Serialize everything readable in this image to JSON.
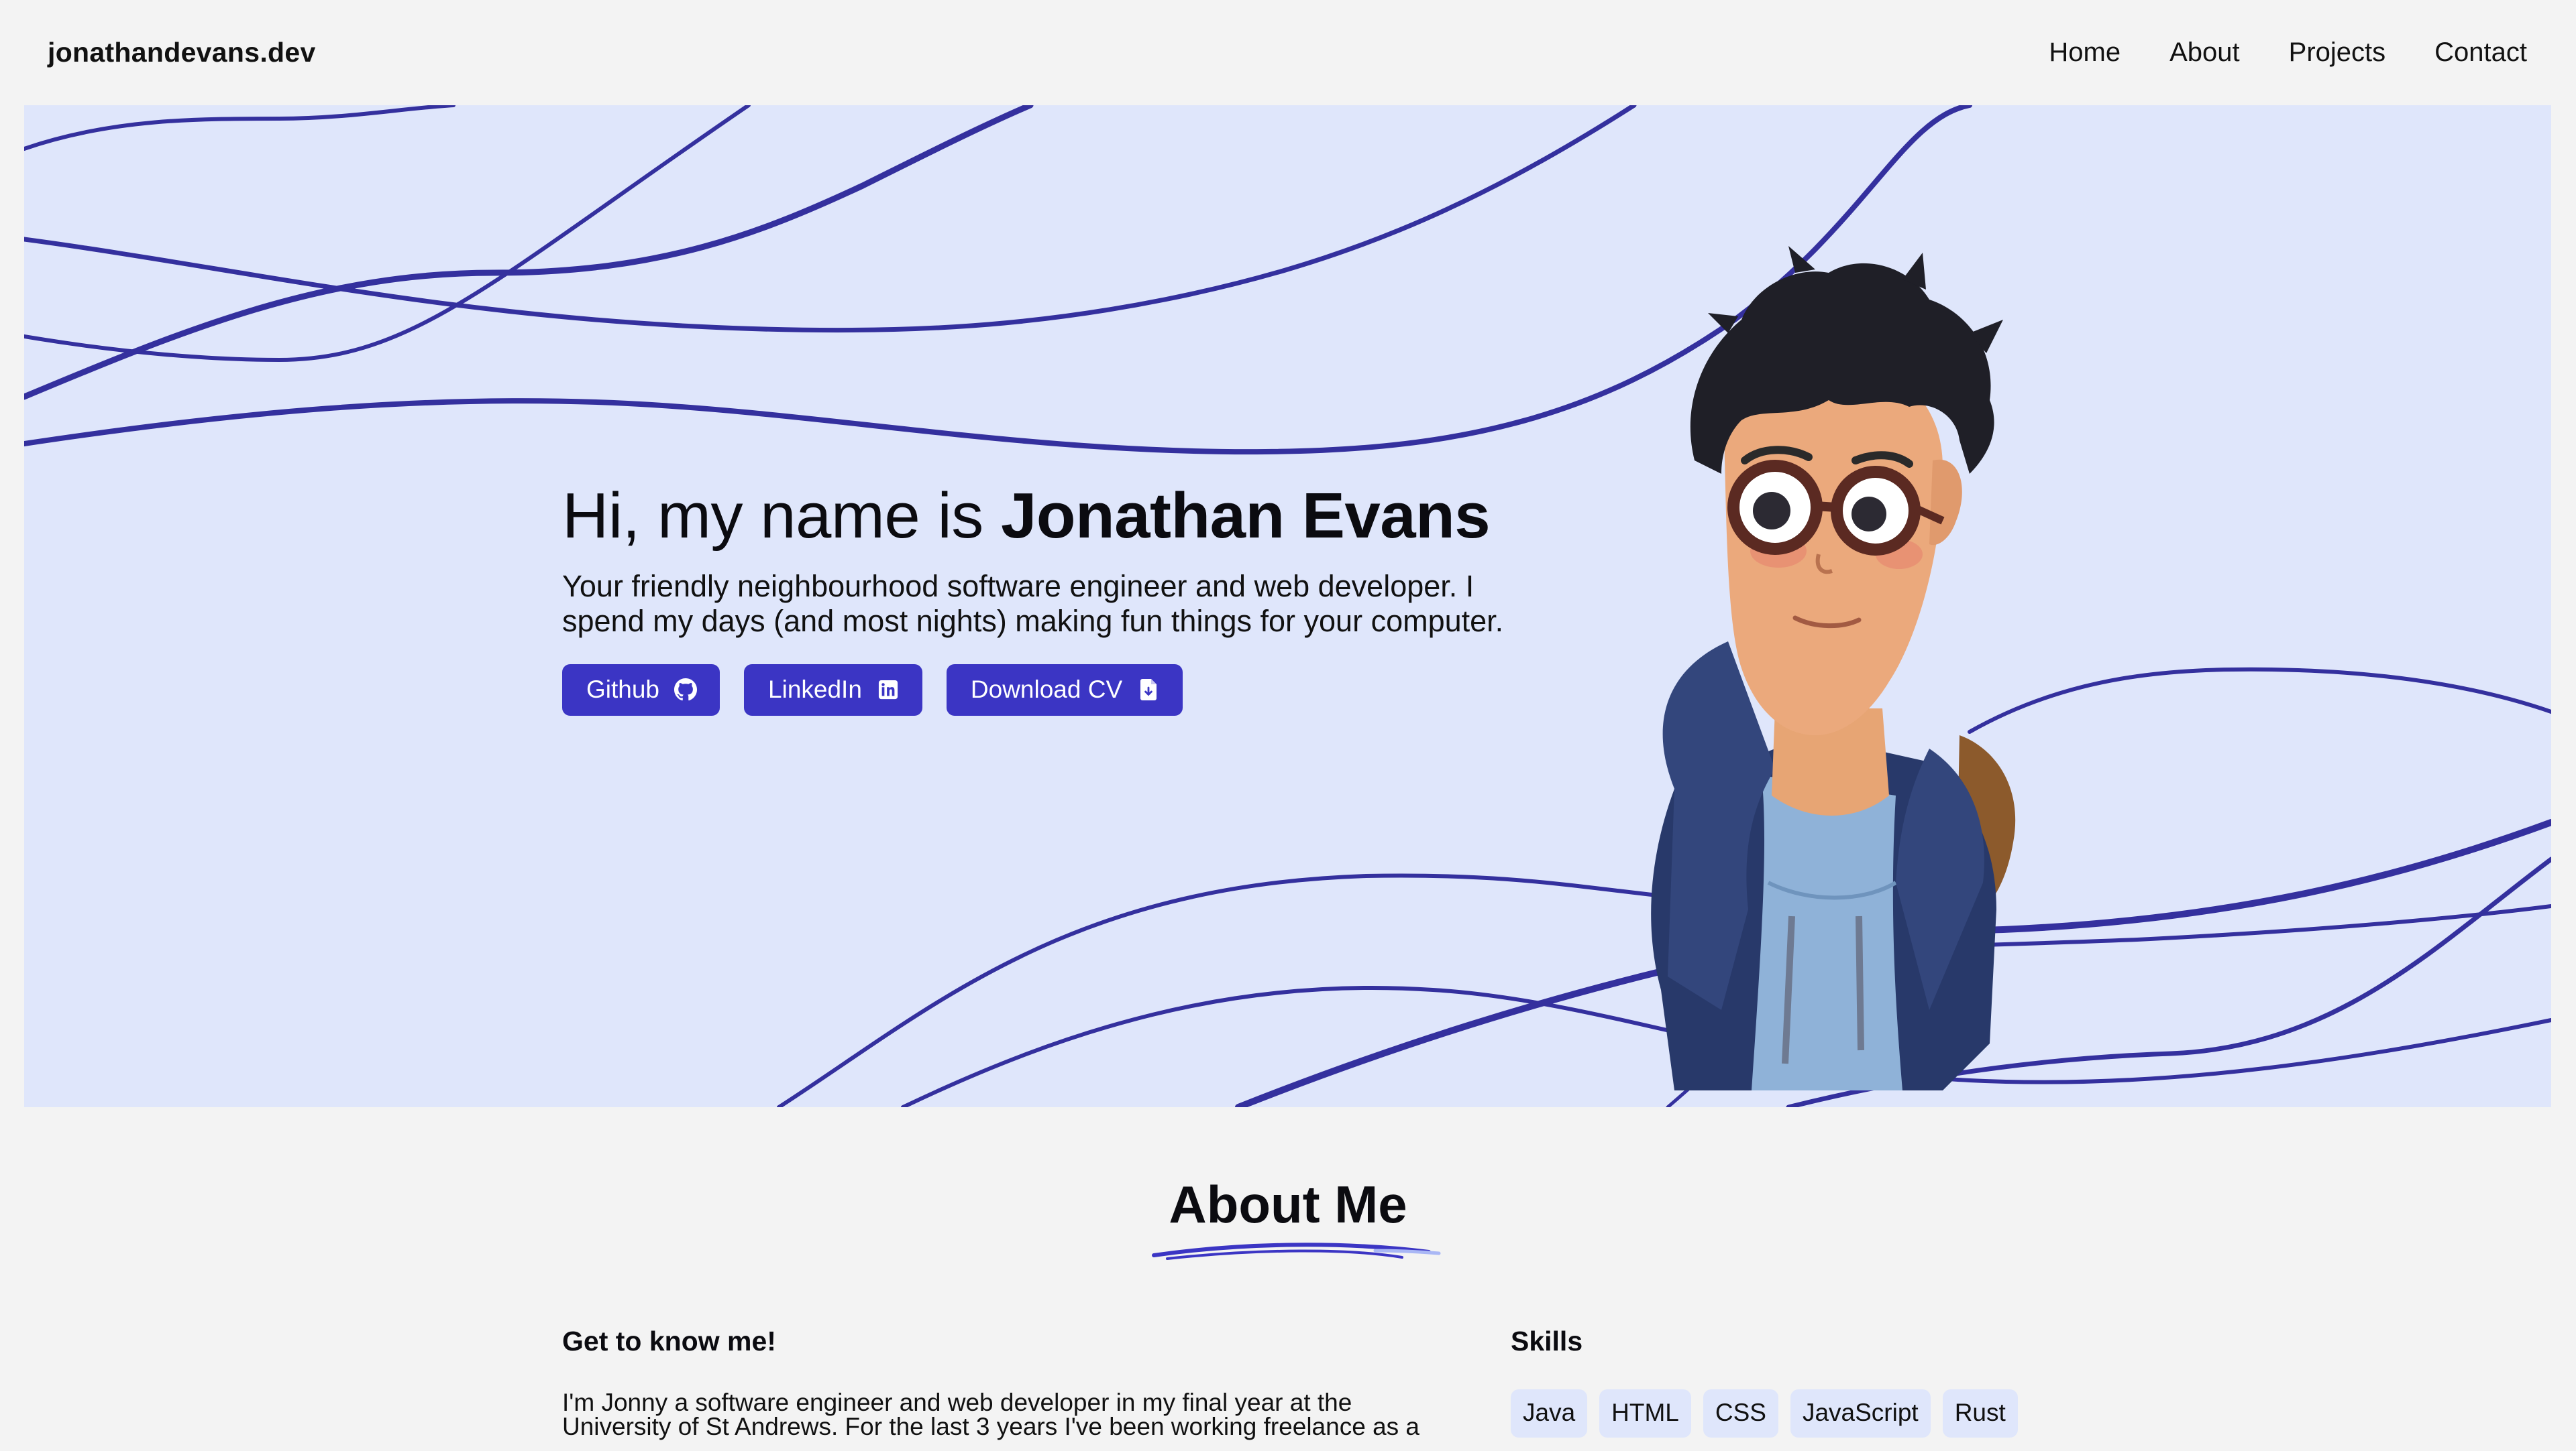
{
  "nav": {
    "brand": "jonathandevans.dev",
    "links": [
      "Home",
      "About",
      "Projects",
      "Contact"
    ]
  },
  "hero": {
    "greeting_prefix": "Hi, my name is ",
    "greeting_name": "Jonathan Evans",
    "tagline": "Your friendly neighbourhood software engineer and web developer. I spend my days (and most nights) making fun things for your computer.",
    "buttons": [
      {
        "label": "Github",
        "icon": "github-icon"
      },
      {
        "label": "LinkedIn",
        "icon": "linkedin-icon"
      },
      {
        "label": "Download CV",
        "icon": "file-download-icon"
      }
    ]
  },
  "about": {
    "title": "About Me",
    "left_heading": "Get to know me!",
    "left_text": "I'm Jonny a software engineer and web developer in my final year at the University of St Andrews. For the last 3 years I've been working freelance as a",
    "right_heading": "Skills",
    "skills": [
      "Java",
      "HTML",
      "CSS",
      "JavaScript",
      "Rust"
    ]
  },
  "colors": {
    "background": "#f3f3f3",
    "hero_background": "#dfe6fb",
    "accent": "#3b35c4",
    "wave_line": "#34309e",
    "skill_tag": "#dfe6fb"
  }
}
